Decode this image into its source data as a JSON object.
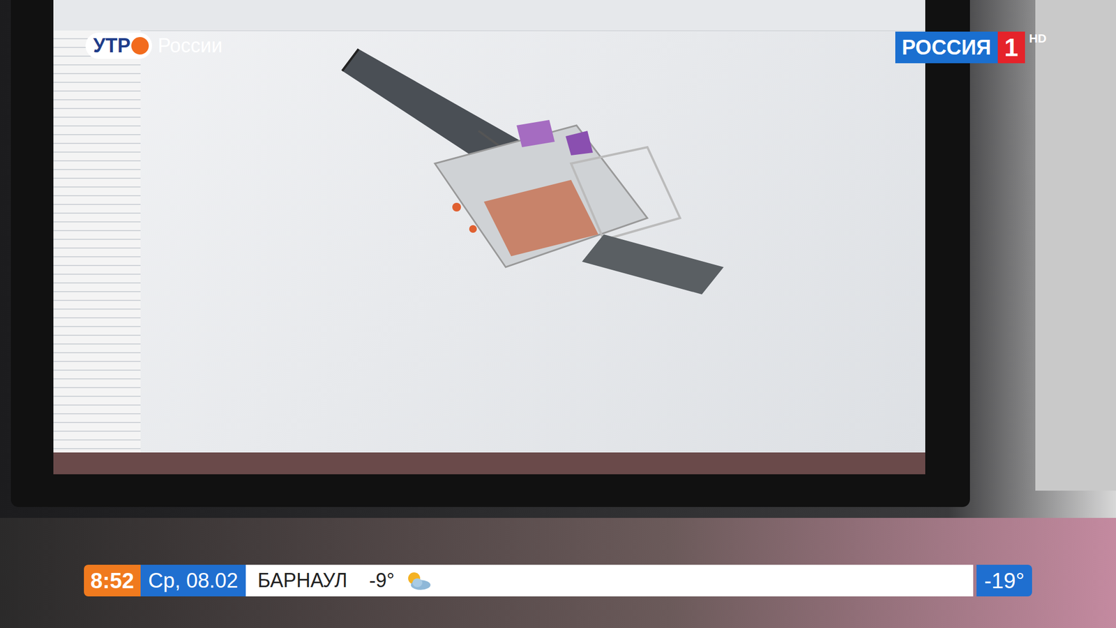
{
  "show_logo": {
    "word": "УТР",
    "region": "России"
  },
  "channel_logo": {
    "name": "РОССИЯ",
    "number": "1",
    "quality": "HD"
  },
  "ticker": {
    "time": "8:52",
    "date": "Ср, 08.02",
    "city": "БАРНАУЛ",
    "city_temp": "-9°",
    "side_temp": "-19°"
  }
}
